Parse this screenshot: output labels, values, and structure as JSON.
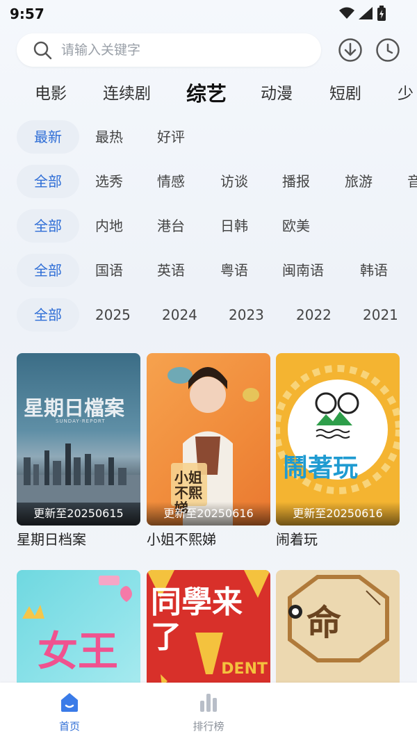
{
  "status": {
    "time": "9:57"
  },
  "search": {
    "placeholder": "请输入关键字",
    "value": ""
  },
  "category_tabs": [
    "电影",
    "连续剧",
    "综艺",
    "动漫",
    "短剧",
    "少"
  ],
  "active_category_index": 2,
  "filters": {
    "sort": [
      "最新",
      "最热",
      "好评"
    ],
    "genre": [
      "全部",
      "选秀",
      "情感",
      "访谈",
      "播报",
      "旅游",
      "音"
    ],
    "region": [
      "全部",
      "内地",
      "港台",
      "日韩",
      "欧美"
    ],
    "language": [
      "全部",
      "国语",
      "英语",
      "粤语",
      "闽南语",
      "韩语"
    ],
    "year": [
      "全部",
      "2025",
      "2024",
      "2023",
      "2022",
      "2021"
    ]
  },
  "cards": [
    {
      "title": "星期日档案",
      "update": "更新至20250615",
      "poster_text": "星期日檔案",
      "poster_sub": "SUNDAY·REPORT"
    },
    {
      "title": "小姐不熙娣",
      "update": "更新至20250616",
      "poster_text": "小姐不熙娣"
    },
    {
      "title": "闹着玩",
      "update": "更新至20250616",
      "poster_text": "鬧著玩"
    },
    {
      "title": "",
      "update": "",
      "poster_text": "女王"
    },
    {
      "title": "",
      "update": "",
      "poster_text": "同學来了",
      "poster_sub": "DENT"
    },
    {
      "title": "",
      "update": "",
      "poster_text": "命"
    }
  ],
  "bottom_nav": [
    {
      "label": "首页",
      "icon": "home-icon",
      "active": true
    },
    {
      "label": "排行榜",
      "icon": "ranking-icon",
      "active": false
    }
  ],
  "colors": {
    "accent": "#2f6ed6",
    "chip_bg": "#e9eef5"
  }
}
